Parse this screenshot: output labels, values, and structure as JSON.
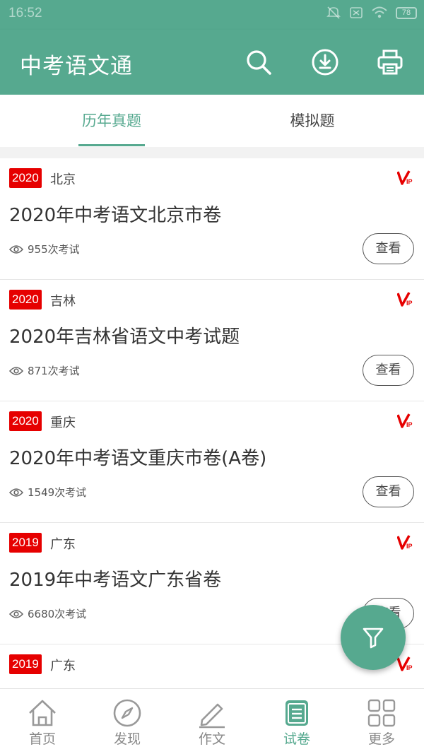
{
  "status_bar": {
    "time": "16:52",
    "battery": "78"
  },
  "app_bar": {
    "title": "中考语文通"
  },
  "tabs": [
    {
      "label": "历年真题",
      "active": true
    },
    {
      "label": "模拟题",
      "active": false
    }
  ],
  "papers": [
    {
      "year": "2020",
      "region": "北京",
      "title": "2020年中考语文北京市卷",
      "views": "955次考试",
      "action": "查看",
      "vip": true
    },
    {
      "year": "2020",
      "region": "吉林",
      "title": "2020年吉林省语文中考试题",
      "views": "871次考试",
      "action": "查看",
      "vip": true
    },
    {
      "year": "2020",
      "region": "重庆",
      "title": "2020年中考语文重庆市卷(A卷)",
      "views": "1549次考试",
      "action": "查看",
      "vip": true
    },
    {
      "year": "2019",
      "region": "广东",
      "title": "2019年中考语文广东省卷",
      "views": "6680次考试",
      "action": "查看",
      "vip": true
    },
    {
      "year": "2019",
      "region": "广东",
      "title": "",
      "views": "",
      "action": "",
      "vip": true
    }
  ],
  "bottom_nav": [
    {
      "label": "首页",
      "icon": "home-icon",
      "active": false
    },
    {
      "label": "发现",
      "icon": "compass-icon",
      "active": false
    },
    {
      "label": "作文",
      "icon": "pencil-icon",
      "active": false
    },
    {
      "label": "试卷",
      "icon": "document-icon",
      "active": true
    },
    {
      "label": "更多",
      "icon": "grid-icon",
      "active": false
    }
  ],
  "colors": {
    "primary": "#56a98f",
    "badge": "#e60000",
    "vip": "#e60000"
  }
}
